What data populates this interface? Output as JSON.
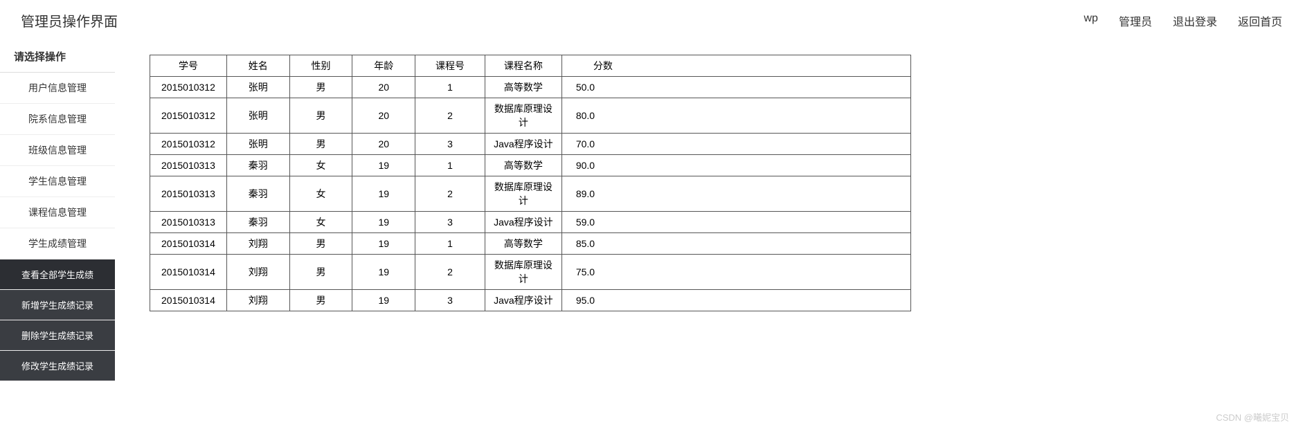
{
  "header": {
    "title": "管理员操作界面",
    "nav": {
      "user": "wp",
      "role": "管理员",
      "logout": "退出登录",
      "home": "返回首页"
    }
  },
  "sidebar": {
    "header": "请选择操作",
    "items": [
      {
        "label": "用户信息管理"
      },
      {
        "label": "院系信息管理"
      },
      {
        "label": "班级信息管理"
      },
      {
        "label": "学生信息管理"
      },
      {
        "label": "课程信息管理"
      },
      {
        "label": "学生成绩管理"
      }
    ],
    "subitems": [
      {
        "label": "查看全部学生成绩"
      },
      {
        "label": "新增学生成绩记录"
      },
      {
        "label": "删除学生成绩记录"
      },
      {
        "label": "修改学生成绩记录"
      }
    ]
  },
  "table": {
    "headers": {
      "student_id": "学号",
      "name": "姓名",
      "gender": "性别",
      "age": "年龄",
      "course_id": "课程号",
      "course_name": "课程名称",
      "score": "分数"
    },
    "rows": [
      {
        "student_id": "2015010312",
        "name": "张明",
        "gender": "男",
        "age": "20",
        "course_id": "1",
        "course_name": "高等数学",
        "score": "50.0"
      },
      {
        "student_id": "2015010312",
        "name": "张明",
        "gender": "男",
        "age": "20",
        "course_id": "2",
        "course_name": "数据库原理设计",
        "score": "80.0"
      },
      {
        "student_id": "2015010312",
        "name": "张明",
        "gender": "男",
        "age": "20",
        "course_id": "3",
        "course_name": "Java程序设计",
        "score": "70.0"
      },
      {
        "student_id": "2015010313",
        "name": "秦羽",
        "gender": "女",
        "age": "19",
        "course_id": "1",
        "course_name": "高等数学",
        "score": "90.0"
      },
      {
        "student_id": "2015010313",
        "name": "秦羽",
        "gender": "女",
        "age": "19",
        "course_id": "2",
        "course_name": "数据库原理设计",
        "score": "89.0"
      },
      {
        "student_id": "2015010313",
        "name": "秦羽",
        "gender": "女",
        "age": "19",
        "course_id": "3",
        "course_name": "Java程序设计",
        "score": "59.0"
      },
      {
        "student_id": "2015010314",
        "name": "刘翔",
        "gender": "男",
        "age": "19",
        "course_id": "1",
        "course_name": "高等数学",
        "score": "85.0"
      },
      {
        "student_id": "2015010314",
        "name": "刘翔",
        "gender": "男",
        "age": "19",
        "course_id": "2",
        "course_name": "数据库原理设计",
        "score": "75.0"
      },
      {
        "student_id": "2015010314",
        "name": "刘翔",
        "gender": "男",
        "age": "19",
        "course_id": "3",
        "course_name": "Java程序设计",
        "score": "95.0"
      }
    ]
  },
  "watermark": "CSDN @曦妮宝贝"
}
